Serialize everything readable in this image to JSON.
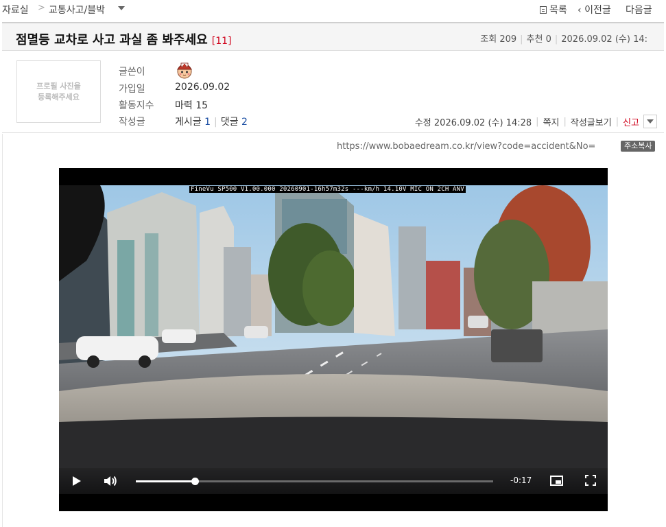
{
  "breadcrumb": {
    "root": "자료실",
    "separator": ">",
    "category": "교통사고/블박"
  },
  "nav": {
    "list": "목록",
    "prev": "이전글",
    "next": "다음글"
  },
  "post": {
    "title": "점멸등 교차로 사고 과실 좀 봐주세요",
    "comment_count": "[11]",
    "views_label": "조회",
    "views": "209",
    "recommend_label": "추천",
    "recommend": "0",
    "date": "2026.09.02 (수) 14:"
  },
  "author": {
    "profile_placeholder_line1": "프로필 사진을",
    "profile_placeholder_line2": "등록해주세요",
    "writer_label": "글쓴이",
    "joined_label": "가입일",
    "joined": "2026.09.02",
    "activity_label": "활동지수",
    "activity_name": "마력",
    "activity_value": "15",
    "posts_label": "작성글",
    "posts_name": "게시글",
    "posts_count": "1",
    "comments_name": "댓글",
    "comments_count": "2"
  },
  "actions": {
    "edited": "수정 2026.09.02 (수) 14:28",
    "message": "쪽지",
    "view_posts": "작성글보기",
    "report": "신고"
  },
  "content": {
    "url": "https://www.bobaedream.co.kr/view?code=accident&No=",
    "copy_button": "주소복사"
  },
  "video": {
    "osd": "FineVu SP500 V1.00.000 20260901-16h57m32s ---km/h 14.10V MIC ON  2CH ANV",
    "time": "-0:17",
    "progress": 0.165
  },
  "colors": {
    "accent_red": "#d0021b",
    "link_blue": "#1b4ea3"
  }
}
